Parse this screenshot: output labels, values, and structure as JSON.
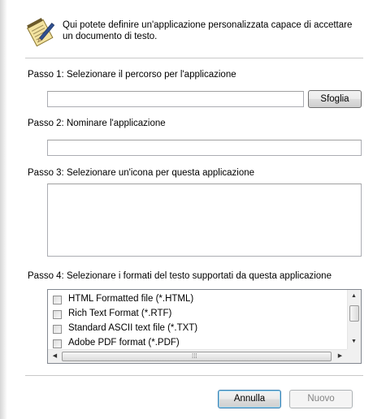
{
  "header": {
    "icon": "notepad-pen-icon",
    "description": "Qui potete definire un'applicazione personalizzata capace di accettare un documento di testo."
  },
  "step1": {
    "label": "Passo 1: Selezionare il percorso per l'applicazione",
    "path_value": "",
    "browse_label": "Sfoglia"
  },
  "step2": {
    "label": "Passo 2: Nominare l'applicazione",
    "name_value": ""
  },
  "step3": {
    "label": "Passo 3: Selezionare un'icona per questa applicazione"
  },
  "step4": {
    "label": "Passo 4: Selezionare i formati del testo supportati da questa applicazione",
    "formats": [
      {
        "label": "HTML Formatted file (*.HTML)",
        "checked": false
      },
      {
        "label": "Rich Text Format (*.RTF)",
        "checked": false
      },
      {
        "label": "Standard ASCII text file (*.TXT)",
        "checked": false
      },
      {
        "label": "Adobe PDF format (*.PDF)",
        "checked": false
      }
    ]
  },
  "footer": {
    "cancel_label": "Annulla",
    "new_label": "Nuovo"
  },
  "colors": {
    "border": "#abadb3",
    "separator": "#c9c9c9",
    "default_button_border": "#3c7fb1",
    "disabled_text": "#838383"
  }
}
